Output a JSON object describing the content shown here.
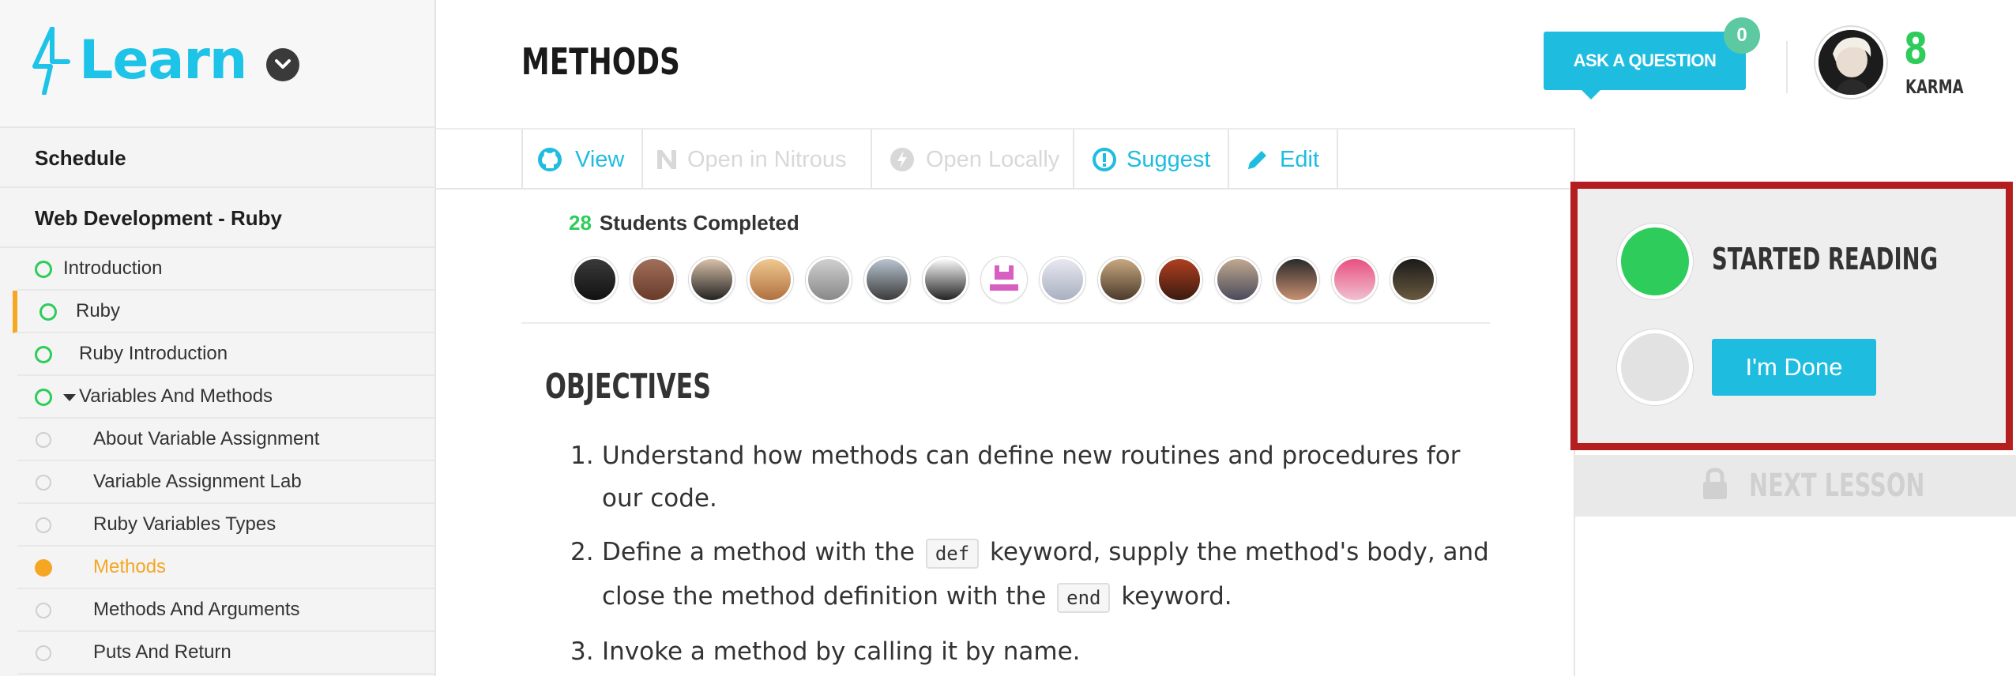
{
  "brand": {
    "logo_text": "Learn",
    "accent": "#1ec3e8"
  },
  "header": {
    "page_title": "METHODS",
    "ask_question_label": "ASK A QUESTION",
    "questions_count": "0",
    "karma_value": "8",
    "karma_label": "KARMA"
  },
  "sidebar": {
    "sections": [
      "Schedule",
      "Web Development - Ruby"
    ],
    "items": [
      {
        "label": "Introduction",
        "status": "started"
      },
      {
        "label": "Ruby",
        "status": "started"
      },
      {
        "label": "Ruby Introduction",
        "status": "started"
      },
      {
        "label": "Variables And Methods",
        "status": "started"
      },
      {
        "label": "About Variable Assignment",
        "status": "not-started"
      },
      {
        "label": "Variable Assignment Lab",
        "status": "not-started"
      },
      {
        "label": "Ruby Variables Types",
        "status": "not-started"
      },
      {
        "label": "Methods",
        "status": "current"
      },
      {
        "label": "Methods And Arguments",
        "status": "not-started"
      },
      {
        "label": "Puts And Return",
        "status": "not-started"
      }
    ]
  },
  "actions": [
    {
      "label": "View",
      "icon": "github-icon",
      "enabled": true
    },
    {
      "label": "Open in Nitrous",
      "icon": "nitrous-icon",
      "enabled": false
    },
    {
      "label": "Open Locally",
      "icon": "bolt-icon",
      "enabled": false
    },
    {
      "label": "Suggest",
      "icon": "alert-icon",
      "enabled": true
    },
    {
      "label": "Edit",
      "icon": "pencil-icon",
      "enabled": true
    }
  ],
  "students": {
    "count": "28",
    "label": "Students Completed",
    "avatars_shown": 15
  },
  "lesson": {
    "objectives_title": "OBJECTIVES",
    "objectives": [
      {
        "num": "1.",
        "parts": [
          "Understand how methods can define new routines and procedures for our code."
        ]
      },
      {
        "num": "2.",
        "parts": [
          "Define a method with the ",
          "def",
          " keyword, supply the method's body, and close the method definition with the ",
          "end",
          " keyword."
        ]
      },
      {
        "num": "3.",
        "parts": [
          "Invoke a method by calling it by name."
        ]
      }
    ]
  },
  "progress": {
    "started_label": "STARTED READING",
    "done_label": "I'm Done",
    "next_lesson_label": "NEXT LESSON"
  },
  "colors": {
    "green": "#2ecc5a",
    "orange": "#f5a623",
    "blue": "#1ebde0",
    "highlight_border": "#b41e1e"
  }
}
